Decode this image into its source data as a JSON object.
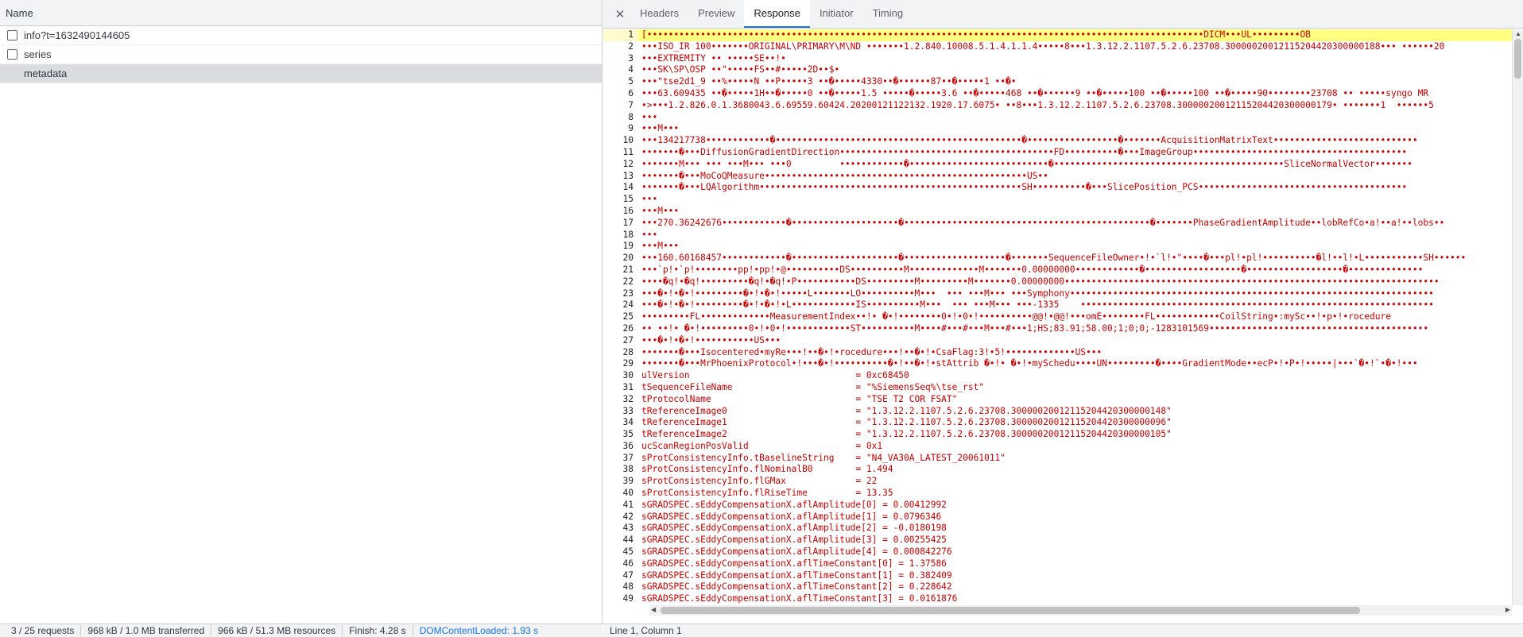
{
  "request_list": {
    "header": "Name",
    "items": [
      {
        "name": "info?t=1632490144605",
        "selected": false
      },
      {
        "name": "series",
        "selected": false
      },
      {
        "name": "metadata",
        "selected": true
      }
    ]
  },
  "summary": {
    "requests": "3 / 25 requests",
    "transferred": "968 kB / 1.0 MB transferred",
    "resources": "966 kB / 51.3 MB resources",
    "finish": "Finish: 4.28 s",
    "dom_content_loaded": "DOMContentLoaded: 1.93 s"
  },
  "tabs": [
    {
      "label": "Headers",
      "active": false
    },
    {
      "label": "Preview",
      "active": false
    },
    {
      "label": "Response",
      "active": true
    },
    {
      "label": "Initiator",
      "active": false
    },
    {
      "label": "Timing",
      "active": false
    }
  ],
  "cursor_position": "Line 1, Column 1",
  "code_lines": [
    "[••••••••••••••••••••••••••••••••••••••••••••••••••••••••••••••••••••••••••••••••••••••••••••••••••••••••DICM•••UL•••••••••OB",
    "•••ISO_IR 100•••••••ORIGINAL\\PRIMARY\\M\\ND •••••••1.2.840.10008.5.1.4.1.1.4•••••8•••1.3.12.2.1107.5.2.6.23708.30000020012115204420300000188••• ••••••20",
    "•••EXTREMITY •• •••••SE••!•",
    "•••SK\\SP\\OSP ••\"•••••FS••#•••••2D••$•",
    "•••\"tse2d1_9 ••%•••••N ••P•••••3 ••�•••••4330••�••••••87••�•••••1 ••�•",
    "•••63.609435 ••�•••••1H••�•••••0 ••�•••••1.5 •••••�•••••3.6 ••�•••••468 ••�••••••9 ••�•••••100 ••�•••••100 ••�•••••90••••••••23708 •• •••••syngo MR",
    "•>•••1.2.826.0.1.3680043.6.69559.60424.20200121122132.1920.17.6075• ••8•••1.3.12.2.1107.5.2.6.23708.30000020012115204420300000179• •••••••1  ••••••5",
    "•••",
    "•••M•••",
    "•••134217738••••••••••••�••••••••••••••••••••••••••••••••••••••••••••••�•••••••••••••••••�•••••••AcquisitionMatrixText•••••••••••••••••••••••••••",
    "•••••••�•••DiffusionGradientDirection••••••••••••••••••••••••••••••••••••••••FD••••••••••�•••ImageGroup••••••••••••••••••••••••••••••••••••••••",
    "•••••••M••• ••• •••M••• •••0         ••••••••••••�••••••••••••••••••••••••••�•••••••••••••••••••••••••••••••••••••••••••SliceNormalVector•••••••",
    "•••••••�•••MoCoQMeasure•••••••••••••••••••••••••••••••••••••••••••••••••US••",
    "•••••••�•••LQAlgorithm•••••••••••••••••••••••••••••••••••••••••••••••••SH••••••••••�•••SlicePosition_PCS•••••••••••••••••••••••••••••••••••••••",
    "•••",
    "•••M•••",
    "•••270.36242676••••••••••••�••••••••••••••••••••�••••••••••••••••••••••••••••••••••••••••••••••�•••••••PhaseGradientAmplitude••lobRefCo•a!••a!••lobs••",
    "•••",
    "•••M•••",
    "•••160.60168457••••••••••••�••••••••••••••••••••�•••••••••••••••••••�•••••••SequenceFileOwner•!•`l!•\"••••�•••pl!•pl!••••••••••�l!••l!•L•••••••••••SH••••••",
    "•••`p!•`p!••••••••pp!•pp!•@••••••••••DS••••••••••M•••••••••••••M•••••••0.00000000••••••••••••�••••••••••••••••••�••••••••••••••••••�••••••••••••••",
    "••••�q!•�q!•••••••••�q!•�q!•P•••••••••••DS•••••••••M•••••••••M•••••••0.00000000••••••••••••••••••••••••••••••••••••••••••••••••••••••••••••••••••••••",
    "•••�•!•�•!•••••••••�•!•�•!•••••L•••••••LO••••••••••M•••  ••• •••M••• •••Symphony••••••••••••••••••••••••••••••••••••••••••••••••••••••••••••••••••••",
    "•••�•!•�•!•••••••••�•!•�•!•L••••••••••••IS••••••••••M•••  ••• •••M••• •••-1335    ••••••••••••••••••••••••••••••••••••••••••••••••••••••••••••••••••",
    "•••••••••FL•••••••••••••MeasurementIndex••!• �•!••••••••0•!•0•!••••••••••@@!•@@!•••omE••••••••FL••••••••••••CoilString•:mySc••!•p•!•rocedure",
    "•• ••!• �•!•••••••••0•!•0•!••••••••••••ST••••••••••M••••#•••#•••M•••#•••1;HS;83.91;58.00;1;0;0;-1283101569•••••••••••••••••••••••••••••••••••••••••",
    "•••�•!•�•!•••••••••••US•••",
    "•••••••�•••Isocentered•myRe•••!••�•!•rocedure•••!••�•!•CsaFlag:3!•5!•••••••••••••US•••",
    "•••••••�•••MrPhoenixProtocol•!•••�•!••••••••••�•!••�•!•stAttrib �•!• �•!•mySchedu••••UN•••••••••�••••GradientMode••ecP•!•P•!•••••|•••`�•!`•�•!•••",
    "ulVersion                               = 0xc68450",
    "tSequenceFileName                       = \"%SiemensSeq%\\tse_rst\"",
    "tProtocolName                           = \"TSE T2 COR FSAT\"",
    "tReferenceImage0                        = \"1.3.12.2.1107.5.2.6.23708.30000020012115204420300000148\"",
    "tReferenceImage1                        = \"1.3.12.2.1107.5.2.6.23708.30000020012115204420300000096\"",
    "tReferenceImage2                        = \"1.3.12.2.1107.5.2.6.23708.30000020012115204420300000105\"",
    "ucScanRegionPosValid                    = 0x1",
    "sProtConsistencyInfo.tBaselineString    = \"N4_VA30A_LATEST_20061011\"",
    "sProtConsistencyInfo.flNominalB0        = 1.494",
    "sProtConsistencyInfo.flGMax             = 22",
    "sProtConsistencyInfo.flRiseTime         = 13.35",
    "sGRADSPEC.sEddyCompensationX.aflAmplitude[0] = 0.00412992",
    "sGRADSPEC.sEddyCompensationX.aflAmplitude[1] = 0.0796346",
    "sGRADSPEC.sEddyCompensationX.aflAmplitude[2] = -0.0180198",
    "sGRADSPEC.sEddyCompensationX.aflAmplitude[3] = 0.00255425",
    "sGRADSPEC.sEddyCompensationX.aflAmplitude[4] = 0.000842276",
    "sGRADSPEC.sEddyCompensationX.aflTimeConstant[0] = 1.37586",
    "sGRADSPEC.sEddyCompensationX.aflTimeConstant[1] = 0.382409",
    "sGRADSPEC.sEddyCompensationX.aflTimeConstant[2] = 0.228642",
    "sGRADSPEC.sEddyCompensationX.aflTimeConstant[3] = 0.0161876",
    ""
  ],
  "colors": {
    "code_text": "#c80000",
    "code_number": "#1a1aa6",
    "highlight": "#ffff80",
    "accent": "#1a73e8"
  }
}
